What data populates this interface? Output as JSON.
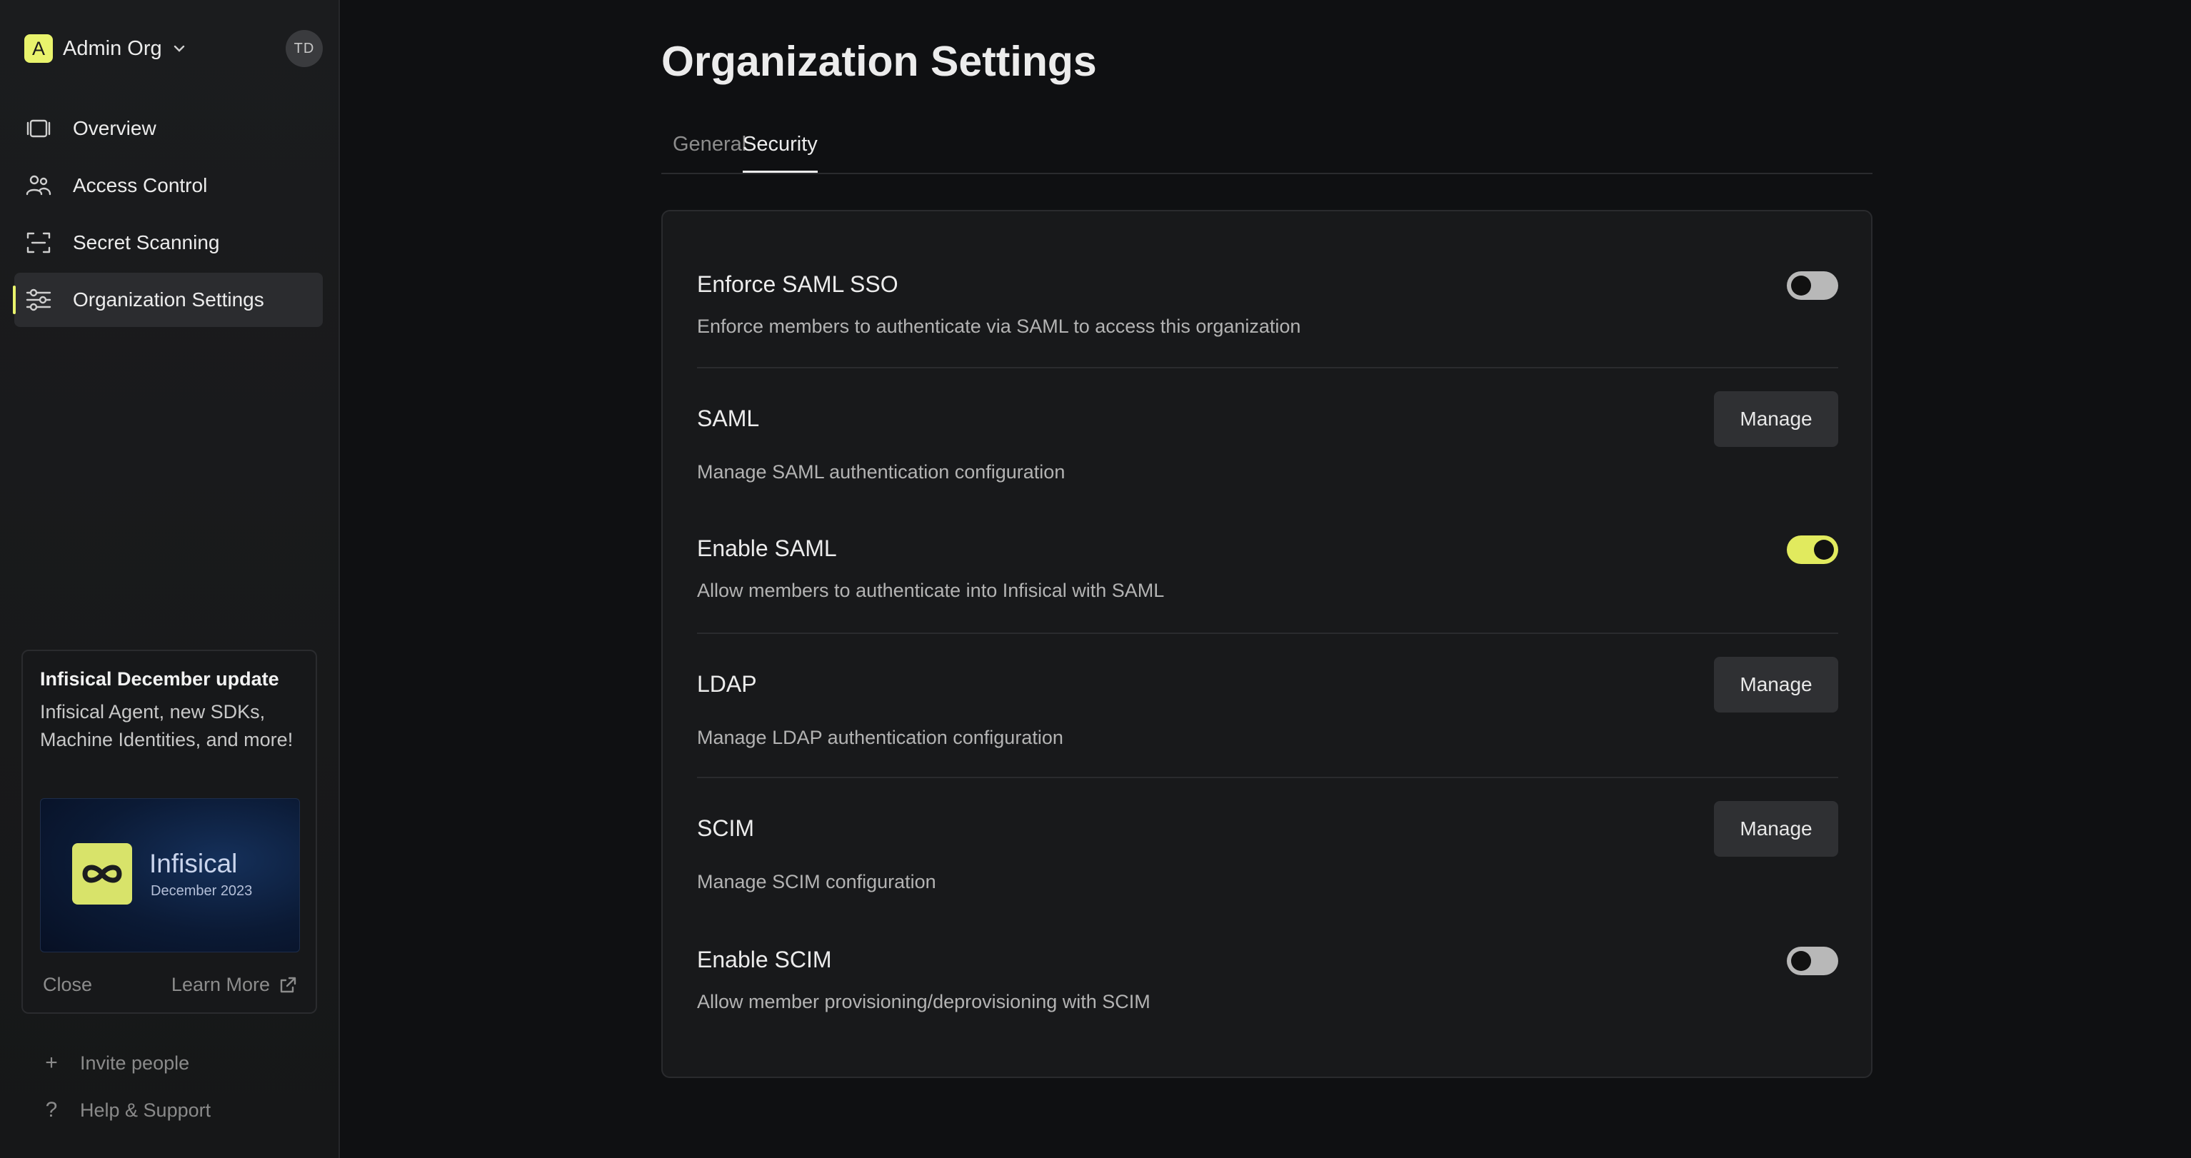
{
  "org": {
    "logo_letter": "A",
    "name": "Admin Org",
    "avatar_initials": "TD"
  },
  "nav": {
    "items": [
      {
        "label": "Overview",
        "icon": "overview-icon"
      },
      {
        "label": "Access Control",
        "icon": "users-icon"
      },
      {
        "label": "Secret Scanning",
        "icon": "scan-icon"
      },
      {
        "label": "Organization Settings",
        "icon": "sliders-icon",
        "active": true
      }
    ]
  },
  "promo": {
    "title": "Infisical December update",
    "description": "Infisical Agent, new SDKs, Machine Identities, and more!",
    "image_brand": "Infisical",
    "image_date": "December 2023",
    "close_label": "Close",
    "learn_more_label": "Learn More"
  },
  "footer": {
    "invite_label": "Invite people",
    "help_label": "Help & Support"
  },
  "page": {
    "title": "Organization Settings",
    "tabs": [
      {
        "label": "General",
        "active": false
      },
      {
        "label": "Security",
        "active": true
      }
    ]
  },
  "security": {
    "enforce_saml": {
      "title": "Enforce SAML SSO",
      "description": "Enforce members to authenticate via SAML to access this organization",
      "enabled": false
    },
    "saml": {
      "title": "SAML",
      "description": "Manage SAML authentication configuration",
      "button": "Manage"
    },
    "enable_saml": {
      "title": "Enable SAML",
      "description": "Allow members to authenticate into Infisical with SAML",
      "enabled": true
    },
    "ldap": {
      "title": "LDAP",
      "description": "Manage LDAP authentication configuration",
      "button": "Manage"
    },
    "scim": {
      "title": "SCIM",
      "description": "Manage SCIM configuration",
      "button": "Manage"
    },
    "enable_scim": {
      "title": "Enable SCIM",
      "description": "Allow member provisioning/deprovisioning with SCIM",
      "enabled": false
    }
  },
  "colors": {
    "accent": "#e9f36c",
    "background": "#0f1012",
    "card": "#18191b"
  }
}
